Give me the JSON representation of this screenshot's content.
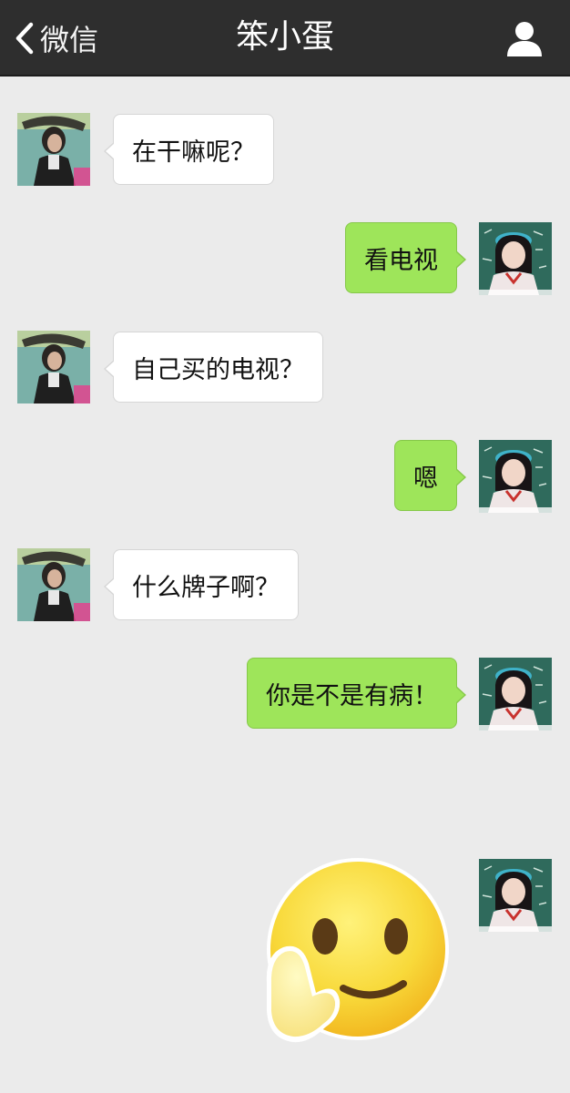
{
  "header": {
    "back_label": "微信",
    "title": "笨小蛋",
    "back_icon": "chevron-left-icon",
    "profile_icon": "person-icon",
    "background": "#2e2e2e"
  },
  "messages": [
    {
      "side": "left",
      "text": "在干嘛呢？"
    },
    {
      "side": "right",
      "text": "看电视"
    },
    {
      "side": "left",
      "text": "自己买的电视？"
    },
    {
      "side": "right",
      "text": "嗯"
    },
    {
      "side": "left",
      "text": "什么牌子啊？"
    },
    {
      "side": "right",
      "text": "你是不是有病！"
    },
    {
      "side": "right",
      "sticker": "smiley-face-with-hand-sticker"
    }
  ],
  "colors": {
    "chat_background": "#ebebeb",
    "sent_bubble": "#9ee55a",
    "received_bubble": "#ffffff"
  }
}
